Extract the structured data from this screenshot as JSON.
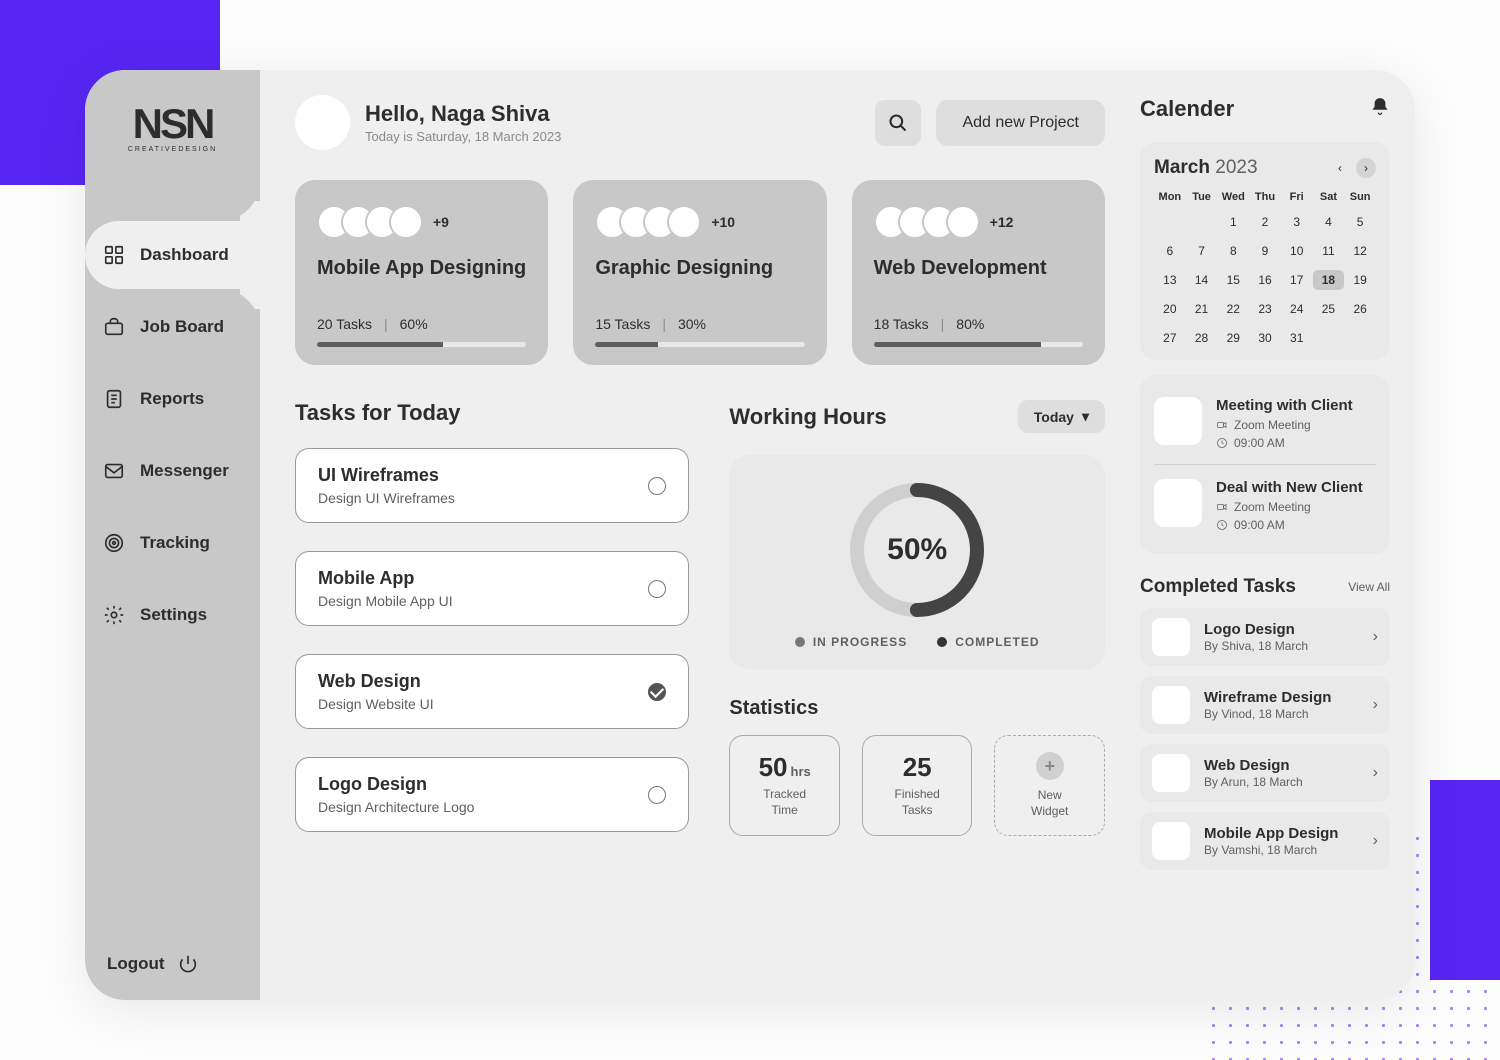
{
  "colors": {
    "accent": "#5725f2"
  },
  "sidebar": {
    "logo": "NSN",
    "logo_sub": "CREATIVEDESIGN",
    "items": [
      {
        "label": "Dashboard",
        "icon": "grid",
        "active": true
      },
      {
        "label": "Job Board",
        "icon": "briefcase",
        "active": false
      },
      {
        "label": "Reports",
        "icon": "report",
        "active": false
      },
      {
        "label": "Messenger",
        "icon": "mail",
        "active": false
      },
      {
        "label": "Tracking",
        "icon": "target",
        "active": false
      },
      {
        "label": "Settings",
        "icon": "gear",
        "active": false
      }
    ],
    "logout_label": "Logout"
  },
  "header": {
    "greeting": "Hello, Naga Shiva",
    "subline": "Today is Saturday, 18 March 2023",
    "add_project_label": "Add new Project"
  },
  "projects": [
    {
      "title": "Mobile App Designing",
      "extra": "+9",
      "tasks": "20 Tasks",
      "pct_label": "60%",
      "pct": 60
    },
    {
      "title": "Graphic Designing",
      "extra": "+10",
      "tasks": "15 Tasks",
      "pct_label": "30%",
      "pct": 30
    },
    {
      "title": "Web Development",
      "extra": "+12",
      "tasks": "18 Tasks",
      "pct_label": "80%",
      "pct": 80
    }
  ],
  "tasks_section": {
    "title": "Tasks  for Today",
    "tasks": [
      {
        "title": "UI Wireframes",
        "sub": "Design UI Wireframes",
        "done": false
      },
      {
        "title": "Mobile App",
        "sub": "Design Mobile App UI",
        "done": false
      },
      {
        "title": "Web Design",
        "sub": "Design Website UI",
        "done": true
      },
      {
        "title": "Logo Design",
        "sub": "Design Architecture Logo",
        "done": false
      }
    ]
  },
  "working_hours": {
    "title": "Working Hours",
    "dropdown": "Today",
    "percent_label": "50%",
    "legend_inprogress": "IN PROGRESS",
    "legend_completed": "COMPLETED"
  },
  "chart_data": {
    "type": "pie",
    "title": "Working Hours",
    "series": [
      {
        "name": "IN PROGRESS",
        "value": 50
      },
      {
        "name": "COMPLETED",
        "value": 50
      }
    ],
    "center_label": "50%"
  },
  "statistics": {
    "title": "Statistics",
    "items": [
      {
        "value": "50",
        "unit": "hrs",
        "label": "Tracked Time"
      },
      {
        "value": "25",
        "unit": "",
        "label": "Finished Tasks"
      }
    ],
    "new_widget_label": "New Widget"
  },
  "calendar": {
    "title": "Calender",
    "month": "March",
    "year": "2023",
    "dow": [
      "Mon",
      "Tue",
      "Wed",
      "Thu",
      "Fri",
      "Sat",
      "Sun"
    ],
    "lead_blanks": 2,
    "days": 31,
    "selected": 18
  },
  "events": [
    {
      "title": "Meeting with Client",
      "where": "Zoom Meeting",
      "time": "09:00 AM"
    },
    {
      "title": "Deal with New Client",
      "where": "Zoom Meeting",
      "time": "09:00 AM"
    }
  ],
  "completed": {
    "title": "Completed Tasks",
    "view_all": "View All",
    "items": [
      {
        "title": "Logo Design",
        "by": "By Shiva, 18 March"
      },
      {
        "title": "Wireframe Design",
        "by": "By Vinod, 18 March"
      },
      {
        "title": "Web Design",
        "by": "By Arun, 18 March"
      },
      {
        "title": "Mobile App Design",
        "by": "By Vamshi, 18 March"
      }
    ]
  }
}
